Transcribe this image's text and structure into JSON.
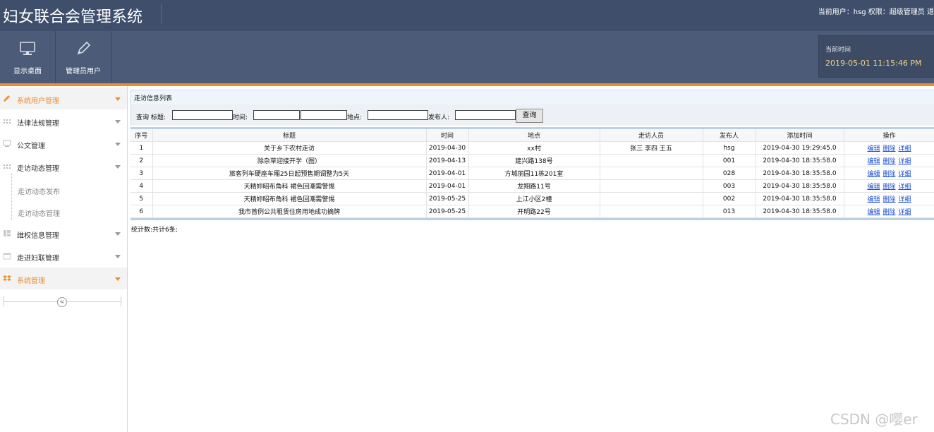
{
  "header": {
    "title": "妇女联合会管理系统",
    "user_info": "当前用户：hsg 权限：超级管理员 退"
  },
  "toolbar": {
    "desktop_label": "显示桌面",
    "admin_label": "管理员用户",
    "time_label": "当前时间",
    "time_value": "2019-05-01 11:15:46 PM"
  },
  "sidebar": {
    "items": [
      {
        "label": "系统用户管理",
        "icon": "pencil-icon",
        "active": true
      },
      {
        "label": "法律法规管理",
        "icon": "grid-icon",
        "active": false
      },
      {
        "label": "公文管理",
        "icon": "monitor-icon",
        "active": false
      },
      {
        "label": "走访动态管理",
        "icon": "grid-icon",
        "active": false
      },
      {
        "label": "维权信息管理",
        "icon": "layout-icon",
        "active": false
      },
      {
        "label": "走进妇联管理",
        "icon": "calendar-icon",
        "active": false
      },
      {
        "label": "系统管理",
        "icon": "dropbox-icon",
        "active": true
      }
    ],
    "sub_items": [
      "走访动态发布",
      "走访动态管理"
    ],
    "collapse_glyph": "<"
  },
  "panel": {
    "title": "走访信息列表"
  },
  "search": {
    "prefix": "查询 标题:",
    "time_label": "时间:",
    "place_label": "地点:",
    "publisher_label": "发布人:",
    "button_label": "查询"
  },
  "table": {
    "headers": [
      "序号",
      "标题",
      "时间",
      "地点",
      "走访人员",
      "发布人",
      "添加时间",
      "操作"
    ],
    "rows": [
      {
        "no": "1",
        "title": "关于乡下农村走访",
        "time": "2019-04-30",
        "place": "xx村",
        "visitors": "张三 李四 王五",
        "publisher": "hsg",
        "added": "2019-04-30 19:29:45.0"
      },
      {
        "no": "2",
        "title": "除杂草迎接开学（图）",
        "time": "2019-04-13",
        "place": "建兴路138号",
        "visitors": "",
        "publisher": "001",
        "added": "2019-04-30 18:35:58.0"
      },
      {
        "no": "3",
        "title": "旅客列车硬座车厢25日起预售期调整为5天",
        "time": "2019-04-01",
        "place": "方城丽园11栋201室",
        "visitors": "",
        "publisher": "028",
        "added": "2019-04-30 18:35:58.0"
      },
      {
        "no": "4",
        "title": "天精妳昭布角科 裙色回潮需警惕",
        "time": "2019-04-01",
        "place": "龙翔路11号",
        "visitors": "",
        "publisher": "003",
        "added": "2019-04-30 18:35:58.0"
      },
      {
        "no": "5",
        "title": "天精妳昭布角科 裙色回潮需警惕",
        "time": "2019-05-25",
        "place": "上江小区2幢",
        "visitors": "",
        "publisher": "002",
        "added": "2019-04-30 18:35:58.0"
      },
      {
        "no": "6",
        "title": "我市首例公共租赁住房用地成功摘牌",
        "time": "2019-05-25",
        "place": "开明路22号",
        "visitors": "",
        "publisher": "013",
        "added": "2019-04-30 18:35:58.0"
      }
    ],
    "ops": [
      "编辑",
      "删除",
      "详细"
    ]
  },
  "stats": "统计数:共计6条;",
  "watermark": "CSDN @嘤er",
  "colors": {
    "header_bg": "#3f4f6b",
    "toolbar_bg": "#4b5b78",
    "accent": "#f08c2a",
    "time_value": "#f3d58a",
    "link": "#1a4fd1"
  }
}
